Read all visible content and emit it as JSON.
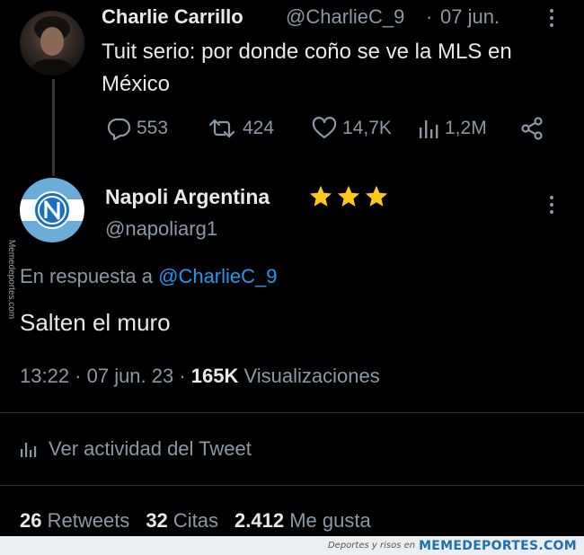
{
  "tweet": {
    "author_name": "Charlie Carrillo",
    "author_handle": "@CharlieC_9",
    "separator": "·",
    "time": "07 jun.",
    "text": "Tuit serio: por donde coño se ve la MLS en México",
    "replies": "553",
    "retweets": "424",
    "likes": "14,7K",
    "views": "1,2M"
  },
  "reply": {
    "author_name": "Napoli Argentina",
    "author_handle": "@napoliarg1",
    "stars": "★★★",
    "in_reply_prefix": "En respuesta a ",
    "in_reply_mention": "@CharlieC_9",
    "text": "Salten el muro",
    "timestamp": "13:22 · 07 jun. 23 · ",
    "views_count": "165K",
    "views_label": " Visualizaciones",
    "activity_label": "Ver actividad del Tweet",
    "stats": {
      "retweets_count": "26",
      "retweets_label": " Retweets",
      "quotes_count": "32",
      "quotes_label": " Citas",
      "likes_count": "2.412",
      "likes_label": " Me gusta"
    }
  },
  "watermark": {
    "side": "Memedeportes.com",
    "footer_small": "Deportes y risos en",
    "footer_site": "MEMEDEPORTES.COM"
  },
  "colors": {
    "background": "#000000",
    "text": "#e7e9ea",
    "secondary": "#8b98a5",
    "accent": "#1d9bf0",
    "star": "#ffc91a"
  }
}
